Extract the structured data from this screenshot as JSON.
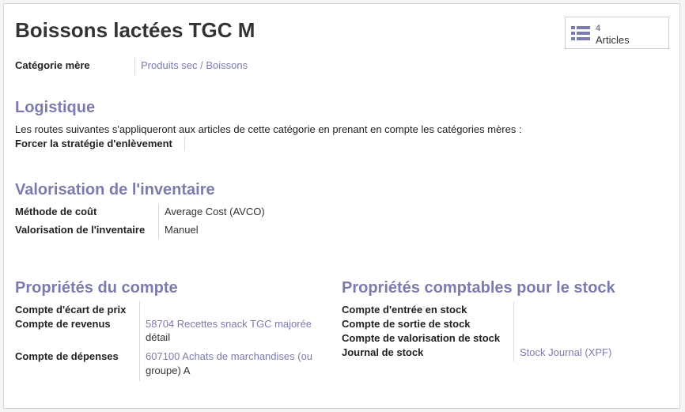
{
  "title": "Boissons lactées TGC M",
  "smart_button": {
    "count": "4",
    "label": "Articles",
    "icon": "list-icon"
  },
  "parent": {
    "label": "Catégorie mère",
    "value": "Produits sec / Boissons"
  },
  "logistics": {
    "heading": "Logistique",
    "note": "Les routes suivantes s'appliqueront aux articles de cette catégorie en prenant en compte les catégories mères :",
    "removal_label": "Forcer la stratégie d'enlèvement",
    "removal_value": ""
  },
  "valuation": {
    "heading": "Valorisation de l'inventaire",
    "cost_method_label": "Méthode de coût",
    "cost_method_value": "Average Cost (AVCO)",
    "valuation_label": "Valorisation de l'inventaire",
    "valuation_value": "Manuel"
  },
  "account": {
    "heading": "Propriétés du compte",
    "price_diff_label": "Compte d'écart de prix",
    "price_diff_value": "",
    "income_label": "Compte de revenus",
    "income_value_line1": "58704 Recettes snack TGC majorée",
    "income_value_line2": "détail",
    "expense_label": "Compte de dépenses",
    "expense_value_line1": "607100 Achats de marchandises (ou",
    "expense_value_line2": "groupe) A"
  },
  "stock_accounting": {
    "heading": "Propriétés comptables pour le stock",
    "input_label": "Compte d'entrée en stock",
    "output_label": "Compte de sortie de stock",
    "valuation_label": "Compte de valorisation de stock",
    "journal_label": "Journal de stock",
    "journal_value": "Stock Journal (XPF)"
  },
  "colors": {
    "accent": "#7c7bad",
    "text": "#333333",
    "separator": "#d9d9d9"
  }
}
